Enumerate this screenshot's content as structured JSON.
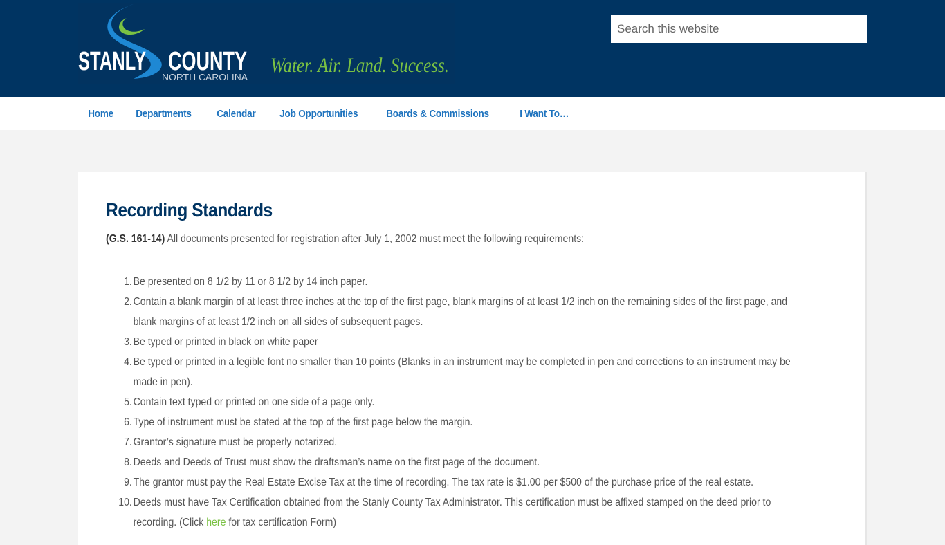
{
  "header": {
    "logo": {
      "name_left": "STANLY",
      "name_right": "COUNTY",
      "subtitle": "NORTH CAROLINA",
      "tagline": "Water. Air. Land. Success."
    },
    "search": {
      "placeholder": "Search this website",
      "value": ""
    }
  },
  "colors": {
    "header_bg": "#003462",
    "nav_link": "#1e73be",
    "title": "#003462",
    "accent_green": "#7ac143",
    "logo_blue": "#1e88d4",
    "page_bg": "#f3f3f3"
  },
  "nav": {
    "items": [
      {
        "label": "Home"
      },
      {
        "label": "Departments"
      },
      {
        "label": "Calendar"
      },
      {
        "label": "Job Opportunities"
      },
      {
        "label": "Boards & Commissions"
      },
      {
        "label": "I Want To…"
      }
    ]
  },
  "main": {
    "title": "Recording Standards",
    "intro_ref": "(G.S. 161-14)",
    "intro_text": " All documents presented for registration after July 1, 2002 must meet the following requirements:",
    "requirements": [
      {
        "num": "1.",
        "text": "Be presented on 8 1/2 by 11 or 8 1/2 by 14 inch paper."
      },
      {
        "num": "2.",
        "text": "Contain a blank margin of at least three inches at the top of the first page, blank margins of at least 1/2 inch on the remaining sides of the first page, and blank margins of at least 1/2 inch on all sides of subsequent pages."
      },
      {
        "num": "3.",
        "text": "Be typed or printed in black on white paper"
      },
      {
        "num": "4.",
        "text": "Be typed or printed in a legible font no smaller than 10 points (Blanks in an instrument may be completed in pen and corrections to an instrument may be made in pen)."
      },
      {
        "num": "5.",
        "text": "Contain text typed or printed on one side of a page only."
      },
      {
        "num": "6.",
        "text": "Type of instrument must be stated at the top of the first page below the margin."
      },
      {
        "num": "7.",
        "text": "Grantor’s signature must be properly notarized."
      },
      {
        "num": "8.",
        "text": "Deeds and Deeds of Trust must show the draftsman’s name on the first page of the document."
      },
      {
        "num": "9.",
        "text": "The grantor must pay the Real Estate Excise Tax at the time of recording. The tax rate is $1.00 per $500 of the purchase price of the real estate."
      },
      {
        "num": "10.",
        "text_before": "Deeds must have Tax Certification obtained from the Stanly County Tax Administrator. This certification must be affixed stamped on the deed prior to recording. (Click ",
        "link": "here",
        "text_after": " for tax certification Form)"
      }
    ]
  }
}
